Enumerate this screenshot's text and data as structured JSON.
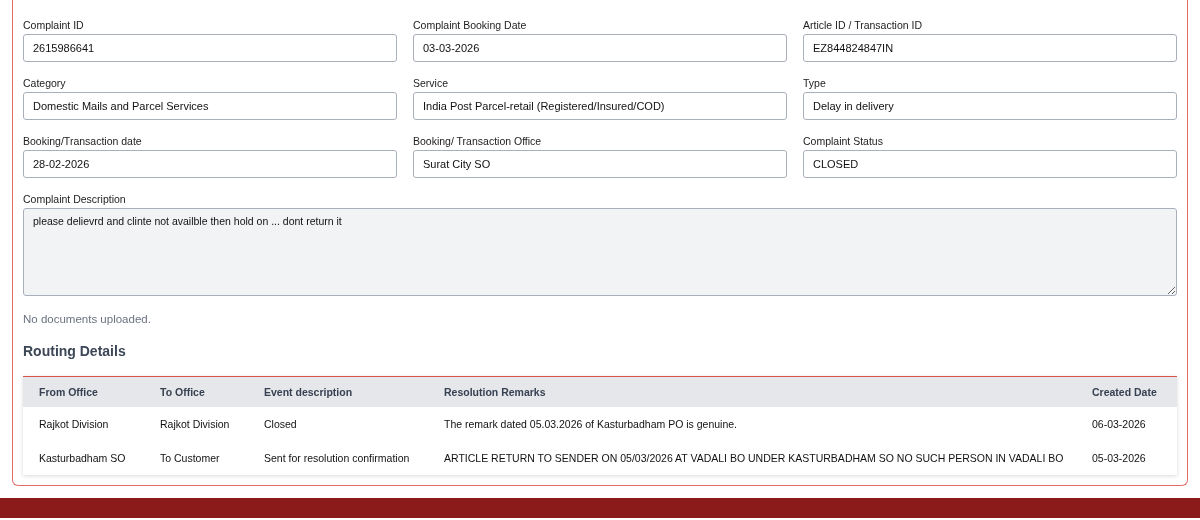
{
  "fields": [
    {
      "label": "Complaint ID",
      "value": "2615986641"
    },
    {
      "label": "Complaint Booking Date",
      "value": "03-03-2026"
    },
    {
      "label": "Article ID / Transaction ID",
      "value": "EZ844824847IN"
    },
    {
      "label": "Category",
      "value": "Domestic Mails and Parcel Services"
    },
    {
      "label": "Service",
      "value": "India Post Parcel-retail (Registered/Insured/COD)"
    },
    {
      "label": "Type",
      "value": "Delay in delivery"
    },
    {
      "label": "Booking/Transaction date",
      "value": "28-02-2026"
    },
    {
      "label": "Booking/ Transaction Office",
      "value": "Surat City SO"
    },
    {
      "label": "Complaint Status",
      "value": "CLOSED"
    }
  ],
  "description": {
    "label": "Complaint Description",
    "value": "please delievrd and clinte not availble then hold on ... dont return it"
  },
  "documents_note": "No documents uploaded.",
  "routing": {
    "title": "Routing Details",
    "columns": [
      "From Office",
      "To Office",
      "Event description",
      "Resolution Remarks",
      "Created Date"
    ],
    "rows": [
      [
        "Rajkot Division",
        "Rajkot Division",
        "Closed",
        "The remark dated 05.03.2026 of Kasturbadham PO is genuine.",
        "06-03-2026"
      ],
      [
        "Kasturbadham SO",
        "To Customer",
        "Sent for resolution confirmation",
        "ARTICLE RETURN TO SENDER ON 05/03/2026 AT VADALI BO UNDER KASTURBADHAM SO NO SUCH PERSON IN VADALI BO",
        "05-03-2026"
      ]
    ]
  }
}
